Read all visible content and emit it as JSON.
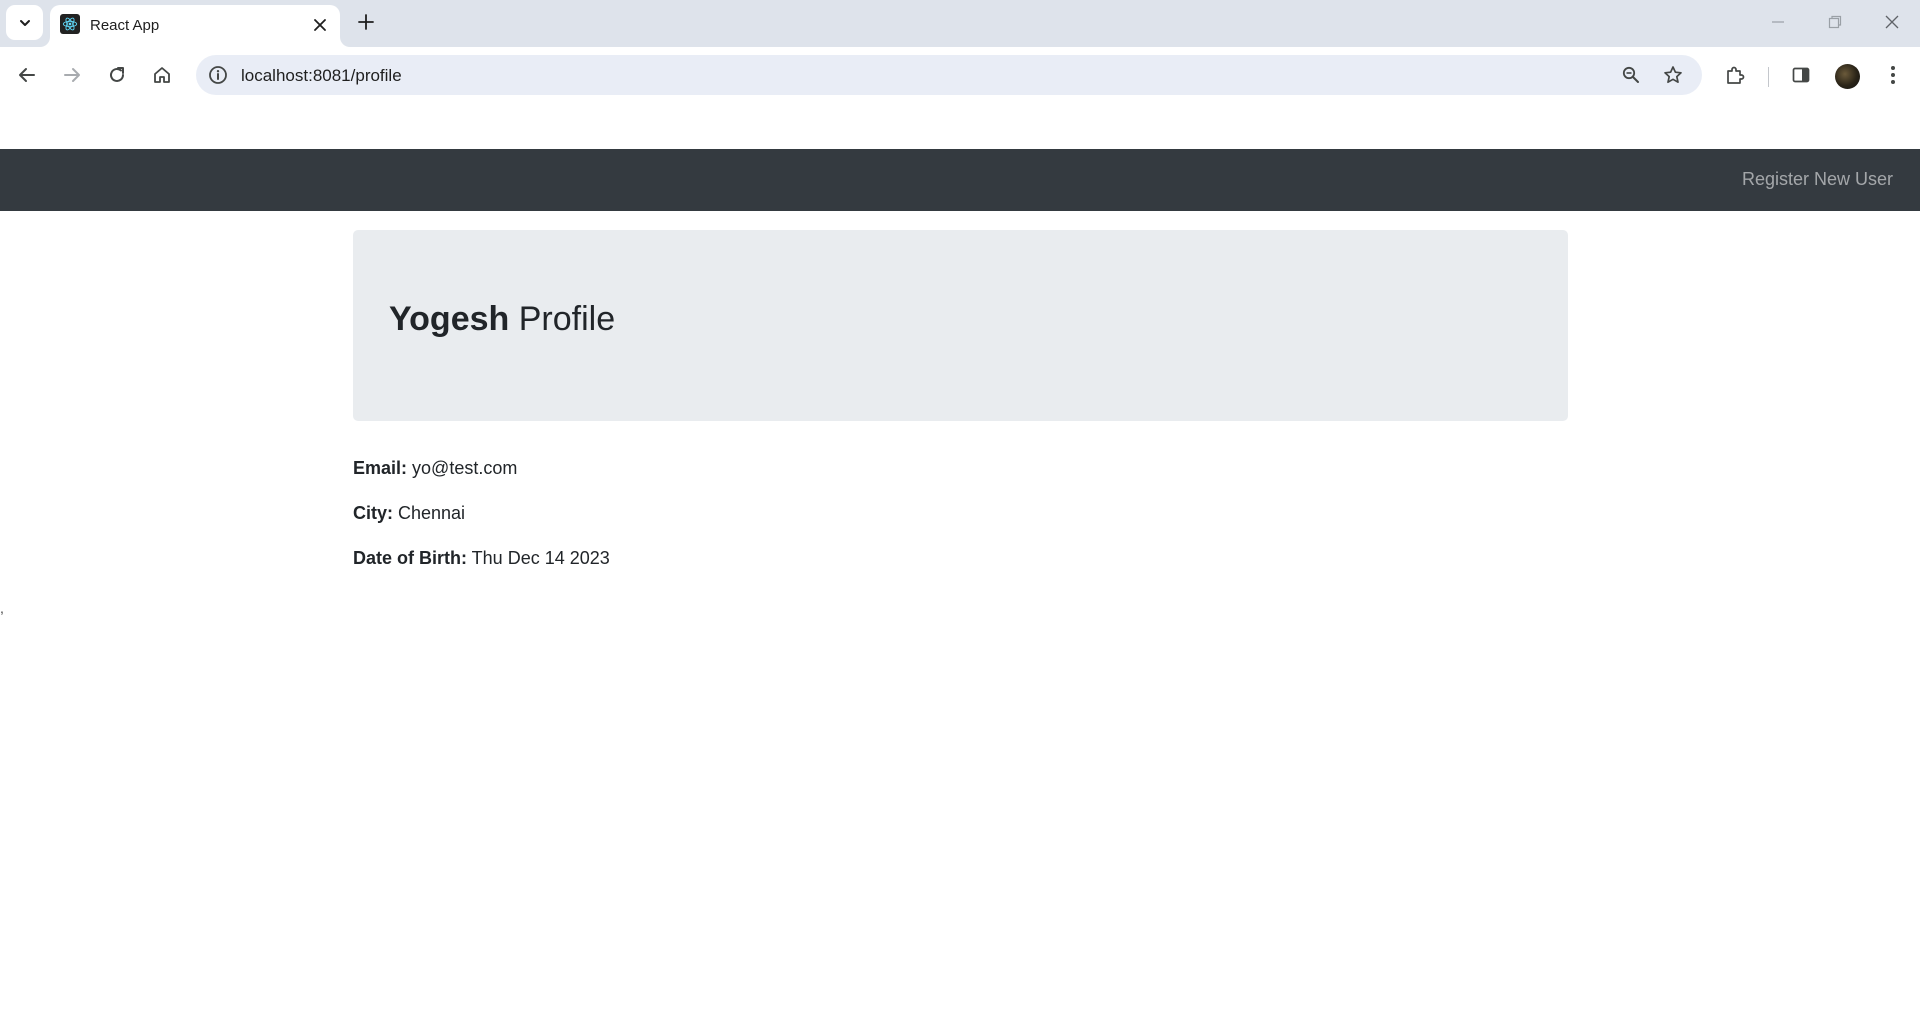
{
  "browser": {
    "tab": {
      "title": "React App"
    },
    "address_bar": {
      "url": "localhost:8081/profile"
    }
  },
  "navbar": {
    "register_link": "Register New User"
  },
  "profile": {
    "name": "Yogesh",
    "title_suffix": " Profile",
    "fields": [
      {
        "label": "Email:",
        "value": " yo@test.com"
      },
      {
        "label": "City:",
        "value": " Chennai"
      },
      {
        "label": "Date of Birth:",
        "value": " Thu Dec 14 2023"
      }
    ]
  },
  "stray_text": ","
}
